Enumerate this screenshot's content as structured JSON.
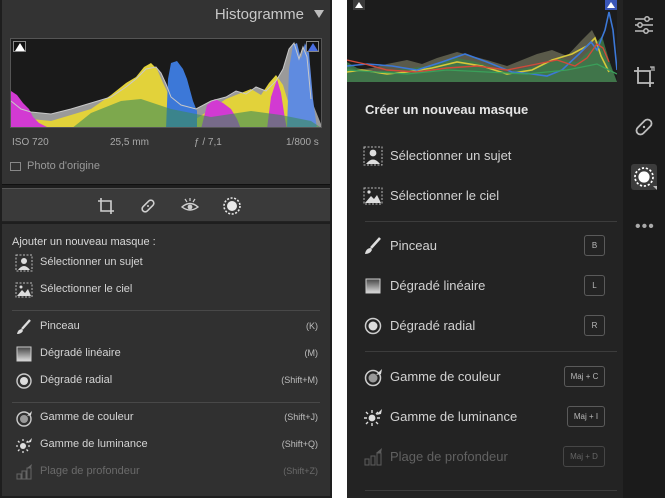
{
  "left": {
    "histogram": {
      "title": "Histogramme",
      "iso": "ISO 720",
      "focal": "25,5 mm",
      "aperture": "ƒ / 7,1",
      "shutter": "1/800 s",
      "original_photo": "Photo d'origine"
    },
    "mask_panel": {
      "title": "Ajouter un nouveau masque :",
      "items": [
        {
          "label": "Sélectionner un sujet",
          "shortcut": ""
        },
        {
          "label": "Sélectionner le ciel",
          "shortcut": ""
        },
        {
          "label": "Pinceau",
          "shortcut": "(K)"
        },
        {
          "label": "Dégradé linéaire",
          "shortcut": "(M)"
        },
        {
          "label": "Dégradé radial",
          "shortcut": "(Shift+M)"
        },
        {
          "label": "Gamme de couleur",
          "shortcut": "(Shift+J)"
        },
        {
          "label": "Gamme de luminance",
          "shortcut": "(Shift+Q)"
        },
        {
          "label": "Plage de profondeur",
          "shortcut": "(Shift+Z)"
        }
      ]
    }
  },
  "right": {
    "mask_panel": {
      "title": "Créer un nouveau masque",
      "items": [
        {
          "label": "Sélectionner un sujet",
          "key": ""
        },
        {
          "label": "Sélectionner le ciel",
          "key": ""
        },
        {
          "label": "Pinceau",
          "key": "B"
        },
        {
          "label": "Dégradé linéaire",
          "key": "L"
        },
        {
          "label": "Dégradé radial",
          "key": "R"
        },
        {
          "label": "Gamme de couleur",
          "key": "Maj + C"
        },
        {
          "label": "Gamme de luminance",
          "key": "Maj + I"
        },
        {
          "label": "Plage de profondeur",
          "key": "Maj + D"
        }
      ]
    },
    "sidebar_icons": [
      "sliders-icon",
      "crop-icon",
      "bandage-icon",
      "mask-icon",
      "more-icon"
    ]
  },
  "colors": {
    "panel_bg": "#303030",
    "text": "#d4d4d4",
    "hist_yellow": "#e2d23a",
    "hist_blue": "#3c78d8",
    "hist_magenta": "#d23ad2"
  }
}
